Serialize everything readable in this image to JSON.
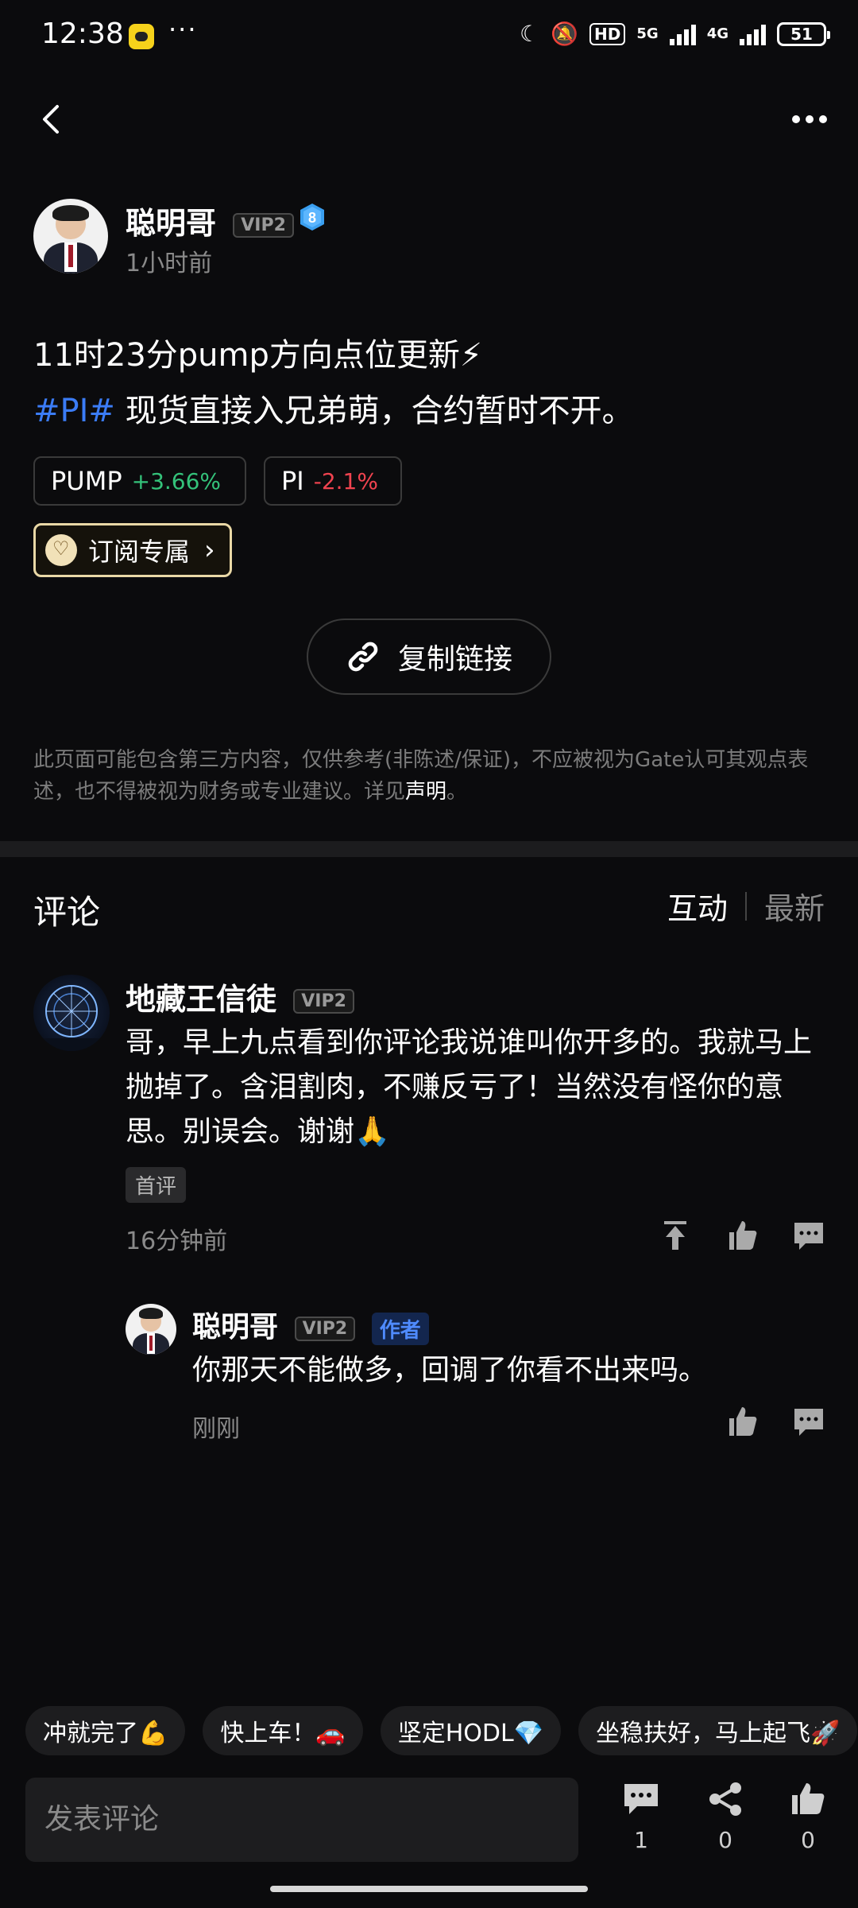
{
  "status_bar": {
    "time": "12:38",
    "more": "···",
    "hd": "HD",
    "net_5g": "5G",
    "net_4g": "4G",
    "battery": "51"
  },
  "post": {
    "author": "聪明哥",
    "vip": "VIP2",
    "level": "8",
    "time": "1小时前",
    "line1": "11时23分pump方向点位更新⚡",
    "hashtag": "#PI#",
    "line2": " 现货直接入兄弟萌，合约暂时不开。",
    "tickers": [
      {
        "symbol": "PUMP",
        "change": "+3.66%"
      },
      {
        "symbol": "PI",
        "change": "-2.1%"
      }
    ],
    "subscribe_label": "订阅专属",
    "copy_link_label": "复制链接",
    "disclaimer_text": "此页面可能包含第三方内容，仅供参考(非陈述/保证)，不应被视为Gate认可其观点表述，也不得被视为财务或专业建议。详见",
    "disclaimer_link": "声明",
    "disclaimer_end": "。"
  },
  "comments_section": {
    "title": "评论",
    "sort_active": "互动",
    "sort_other": "最新",
    "comments": [
      {
        "name": "地藏王信徒",
        "vip": "VIP2",
        "text": "哥，早上九点看到你评论我说谁叫你开多的。我就马上抛掉了。含泪割肉，不赚反亏了！当然没有怪你的意思。别误会。谢谢🙏",
        "tag": "首评",
        "time": "16分钟前"
      }
    ],
    "reply": {
      "name": "聪明哥",
      "vip": "VIP2",
      "author_tag": "作者",
      "text": "你那天不能做多，回调了你看不出来吗。",
      "time": "刚刚"
    }
  },
  "quick_replies": [
    "冲就完了💪",
    "快上车！🚗",
    "坚定HODL💎",
    "坐稳扶好，马上起飞🚀"
  ],
  "bottom_bar": {
    "input_placeholder": "发表评论",
    "comment_count": "1",
    "share_count": "0",
    "like_count": "0"
  }
}
